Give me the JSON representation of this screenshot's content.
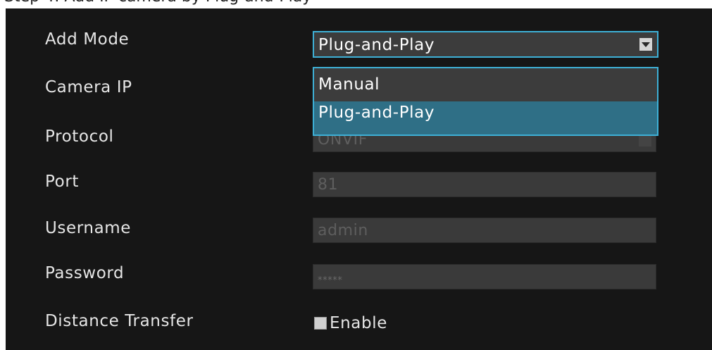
{
  "top_strip_text": "Step 4: Add IP camera by Plug-and-Play",
  "form": {
    "add_mode": {
      "label": "Add Mode",
      "value": "Plug-and-Play",
      "options": [
        "Manual",
        "Plug-and-Play"
      ],
      "expanded": true,
      "highlighted_option": "Plug-and-Play"
    },
    "camera_ip": {
      "label": "Camera IP",
      "value": ""
    },
    "protocol": {
      "label": "Protocol",
      "value": "ONVIF"
    },
    "port": {
      "label": "Port",
      "value": "81"
    },
    "username": {
      "label": "Username",
      "value": "admin"
    },
    "password": {
      "label": "Password",
      "value": "*****"
    },
    "distance_transfer": {
      "label": "Distance Transfer",
      "checkbox_label": "Enable",
      "checked": false
    }
  },
  "colors": {
    "background": "#161616",
    "field_disabled": "#3a3a3a",
    "accent_border": "#3eb0d6",
    "option_highlight": "#2f6f86",
    "label_text": "#e6e6e6",
    "disabled_text": "#5e5e5e"
  },
  "icons": {
    "dropdown_arrow": "chevron-down-icon",
    "checkbox": "checkbox-icon"
  }
}
